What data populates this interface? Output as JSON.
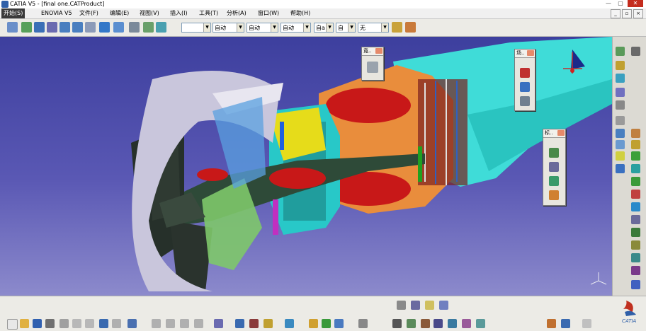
{
  "window": {
    "title": "CATIA V5 - [final one.CATProduct]"
  },
  "menu": {
    "items": [
      "开始(S)",
      "ENOVIA V5",
      "文件(F)",
      "编辑(E)",
      "视图(V)",
      "插入(I)",
      "工具(T)",
      "分析(A)",
      "窗口(W)",
      "帮助(H)"
    ]
  },
  "toolbar": {
    "combos": [
      "",
      "自动",
      "自动",
      "自动",
      "自a",
      "自",
      "无"
    ]
  },
  "palettes": {
    "p1_title": "竟..",
    "p2_title": "场..",
    "p3_title": "标.."
  },
  "brand": {
    "name": "CATIA",
    "accent": "#2f5fa8"
  },
  "colors": {
    "viewport_top": "#3d3f9e",
    "viewport_bottom": "#8c8acc",
    "cyan_part": "#3fe0dc"
  }
}
